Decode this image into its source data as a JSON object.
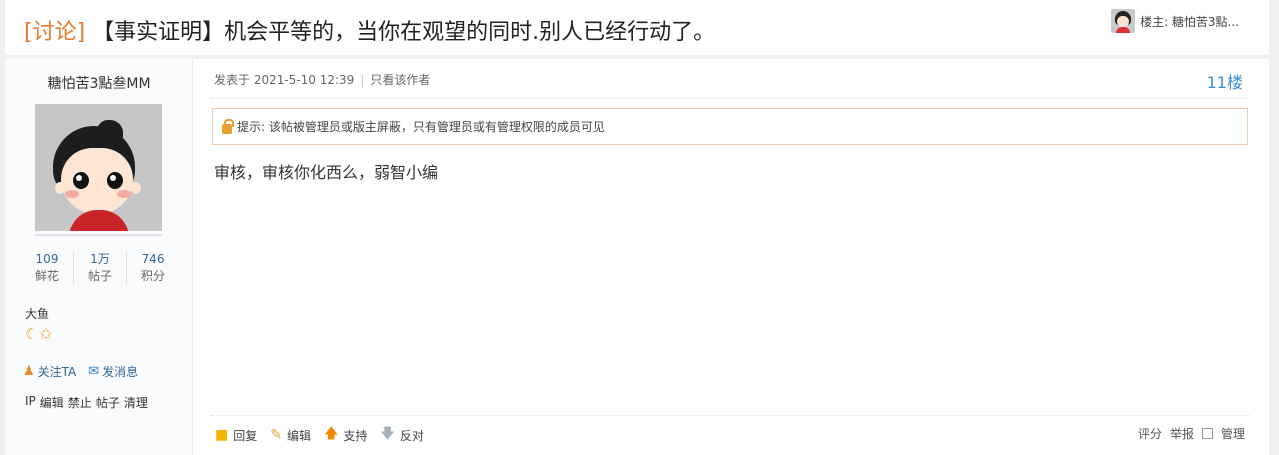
{
  "thread": {
    "tag": "[讨论]",
    "title": "【事实证明】机会平等的，当你在观望的同时.别人已经行动了。",
    "owner_label": "楼主: 糖怕苦3點..."
  },
  "author": {
    "username": "糖怕苦3點叁MM",
    "stats": [
      {
        "value": "109",
        "label": "鲜花"
      },
      {
        "value": "1万",
        "label": "帖子"
      },
      {
        "value": "746",
        "label": "积分"
      }
    ],
    "rank": "大鱼",
    "badges": [
      "☾",
      "✩"
    ],
    "follow_label": "关注TA",
    "message_label": "发消息",
    "manage_links": [
      "IP",
      "编辑",
      "禁止",
      "帖子",
      "清理"
    ]
  },
  "post": {
    "posted_at": "发表于 2021-5-10 12:39",
    "author_only": "只看该作者",
    "floor": "11楼",
    "notice": "提示: 该帖被管理员或版主屏蔽，只有管理员或有管理权限的成员可见",
    "content": "审核，审核你化西么，弱智小编"
  },
  "footer": {
    "reply": "回复",
    "edit": "编辑",
    "support": "支持",
    "oppose": "反对",
    "rate": "评分",
    "report": "举报",
    "manage": "管理"
  }
}
